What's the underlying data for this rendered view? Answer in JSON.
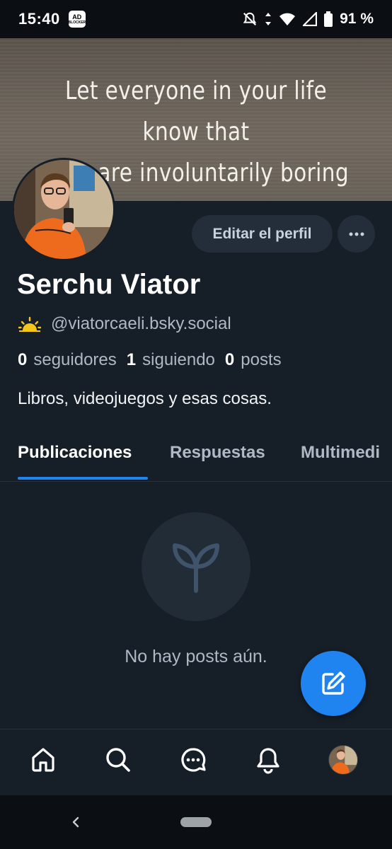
{
  "status_bar": {
    "time": "15:40",
    "ad_badge_top": "AD",
    "ad_badge_bottom": "BLOCKER",
    "battery": "91 %"
  },
  "banner": {
    "text": "Let everyone in your life know that\nthey are involuntarily boring"
  },
  "profile": {
    "display_name": "Serchu Viator",
    "handle": "@viatorcaeli.bsky.social",
    "handle_emoji": "sunrise-icon",
    "stats": {
      "followers_count": "0",
      "followers_label": "seguidores",
      "following_count": "1",
      "following_label": "siguiendo",
      "posts_count": "0",
      "posts_label": "posts"
    },
    "bio": "Libros, videojuegos y esas cosas."
  },
  "actions": {
    "edit_label": "Editar el perfil",
    "more_icon": "ellipsis-icon"
  },
  "tabs": [
    {
      "label": "Publicaciones",
      "active": true
    },
    {
      "label": "Respuestas",
      "active": false
    },
    {
      "label": "Multimedi",
      "active": false
    }
  ],
  "empty_state": {
    "icon": "sprout-icon",
    "text": "No hay posts aún."
  },
  "fab": {
    "icon": "compose-icon"
  },
  "bottom_nav": [
    "home-icon",
    "search-icon",
    "chat-icon",
    "bell-icon",
    "profile-avatar"
  ],
  "colors": {
    "accent": "#1f84f0",
    "background": "#161e27",
    "muted_text": "#aeb9c5"
  }
}
